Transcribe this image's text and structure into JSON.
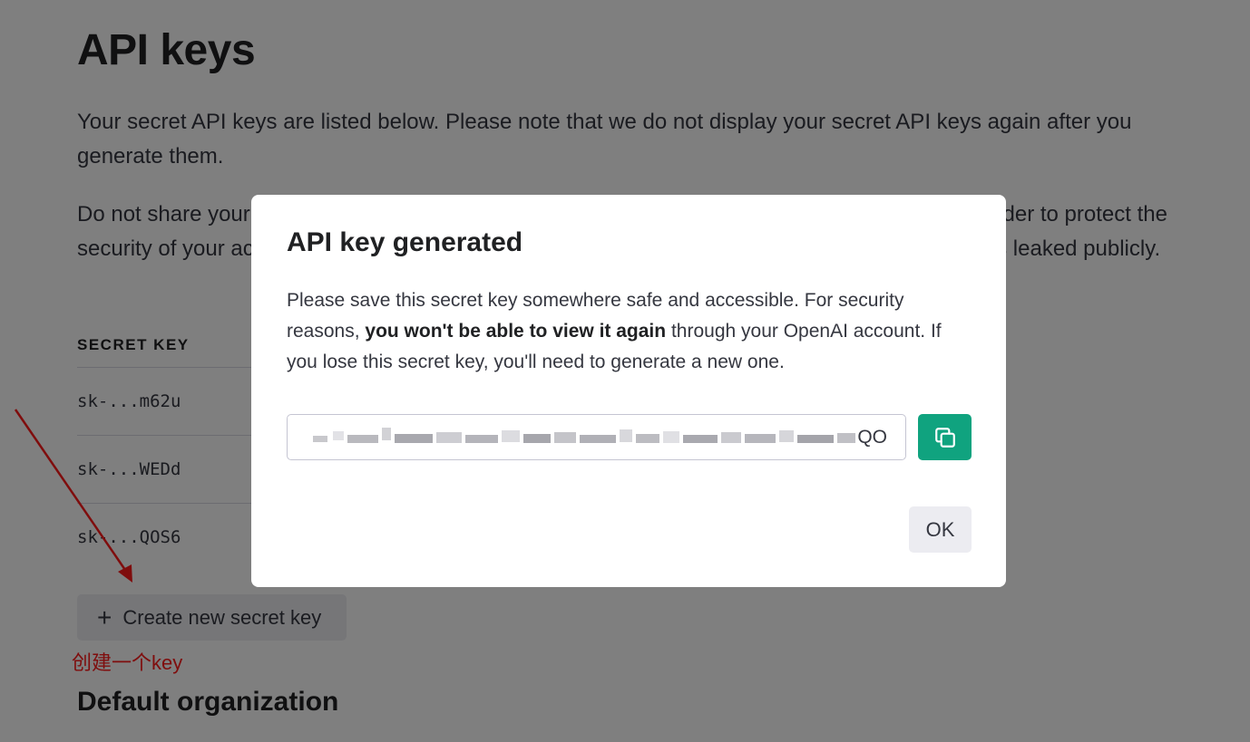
{
  "page": {
    "title": "API keys",
    "intro_1": "Your secret API keys are listed below. Please note that we do not display your secret API keys again after you generate them.",
    "intro_2": "Do not share your API key with others, or expose it in the browser or other client-side code. In order to protect the security of your account, OpenAI may also automatically rotate any API key that we've found has leaked publicly.",
    "table_header": "SECRET KEY",
    "keys": [
      "sk-...m62u",
      "sk-...WEDd",
      "sk-...QOS6"
    ],
    "create_button_label": "Create new secret key",
    "annotation_text": "创建一个key",
    "section_title": "Default organization"
  },
  "modal": {
    "title": "API key generated",
    "body_prefix": "Please save this secret key somewhere safe and accessible. For security reasons,",
    "body_bold": "you won't be able to view it again",
    "body_suffix": "through your OpenAI account. If you lose this secret key, you'll need to generate a new one.",
    "key_visible_suffix": "QO",
    "ok_label": "OK"
  },
  "colors": {
    "accent": "#10a37f",
    "overlay": "rgba(0,0,0,0.5)",
    "annotation": "#ff1a1a"
  },
  "icons": {
    "plus": "plus-icon",
    "copy": "copy-icon",
    "arrow": "annotation-arrow"
  }
}
